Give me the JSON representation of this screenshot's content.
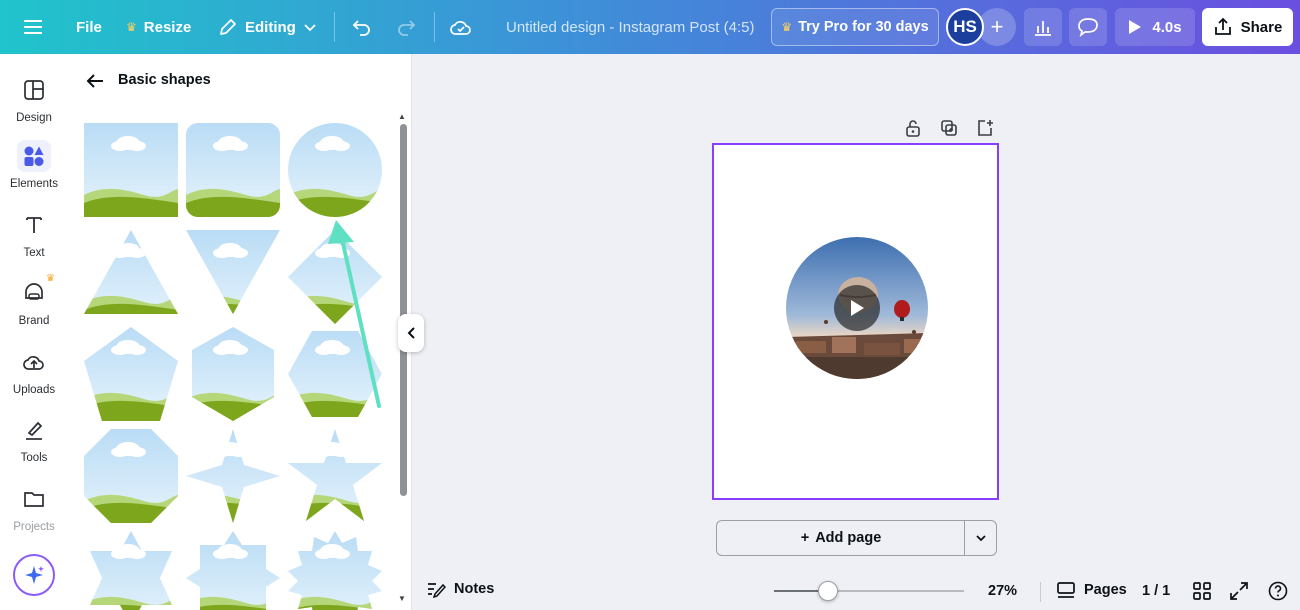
{
  "topbar": {
    "file": "File",
    "resize": "Resize",
    "editing": "Editing",
    "document_title": "Untitled design - Instagram Post (4:5)",
    "try_pro": "Try Pro for 30 days",
    "avatar_initials": "HS",
    "play_duration": "4.0s",
    "share": "Share"
  },
  "rail": {
    "items": [
      {
        "label": "Design",
        "icon": "layout-icon"
      },
      {
        "label": "Elements",
        "icon": "shapes-icon"
      },
      {
        "label": "Text",
        "icon": "text-icon"
      },
      {
        "label": "Brand",
        "icon": "brand-icon"
      },
      {
        "label": "Uploads",
        "icon": "cloud-upload-icon"
      },
      {
        "label": "Tools",
        "icon": "pen-tool-icon"
      },
      {
        "label": "Projects",
        "icon": "folder-icon"
      }
    ],
    "active": "Elements"
  },
  "panel": {
    "title": "Basic shapes",
    "shapes": [
      "square",
      "rounded-square",
      "circle",
      "triangle",
      "inverted-triangle",
      "diamond",
      "pentagon",
      "hexagon",
      "hexagon-horizontal",
      "octagon",
      "four-point-star",
      "five-point-star",
      "six-point-star",
      "eight-point-burst",
      "twelve-point-burst"
    ]
  },
  "canvas": {
    "add_page": "Add page"
  },
  "bottombar": {
    "notes": "Notes",
    "zoom": "27%",
    "zoom_level": 0.27,
    "pages": "Pages",
    "page_count": "1 / 1"
  },
  "colors": {
    "accent_purple": "#8b3dff",
    "sky": "#cfe6f7",
    "grass": "#7ea61d",
    "arrow": "#5fe0c2"
  }
}
